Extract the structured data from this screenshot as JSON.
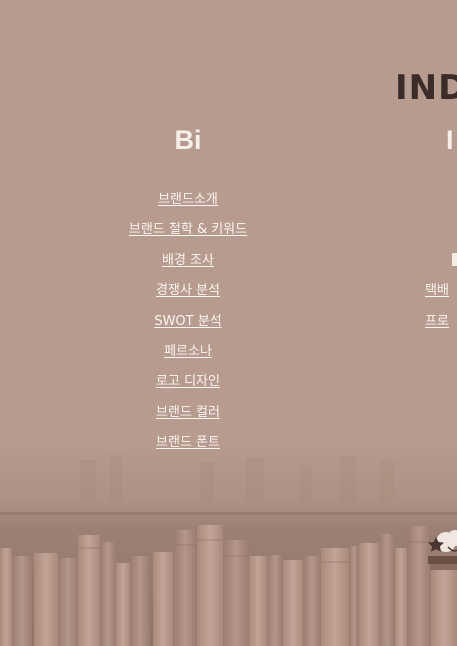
{
  "header": {
    "index_title": "IND"
  },
  "columns": [
    {
      "heading": "Bi",
      "links": [
        "브랜드소개",
        "브랜드 철학 & 키워드",
        "배경 조사",
        "경쟁사 분석",
        "SWOT 분석",
        "페르소나",
        "로고 디자인",
        "브랜드 컬러",
        "브랜드 폰트"
      ]
    },
    {
      "heading": "I",
      "links": [
        "",
        "",
        "",
        "택배",
        "프로"
      ]
    }
  ],
  "colors": {
    "background": "#b79b8e",
    "title": "#3b2c2a",
    "link_text": "#fbf5f1"
  }
}
